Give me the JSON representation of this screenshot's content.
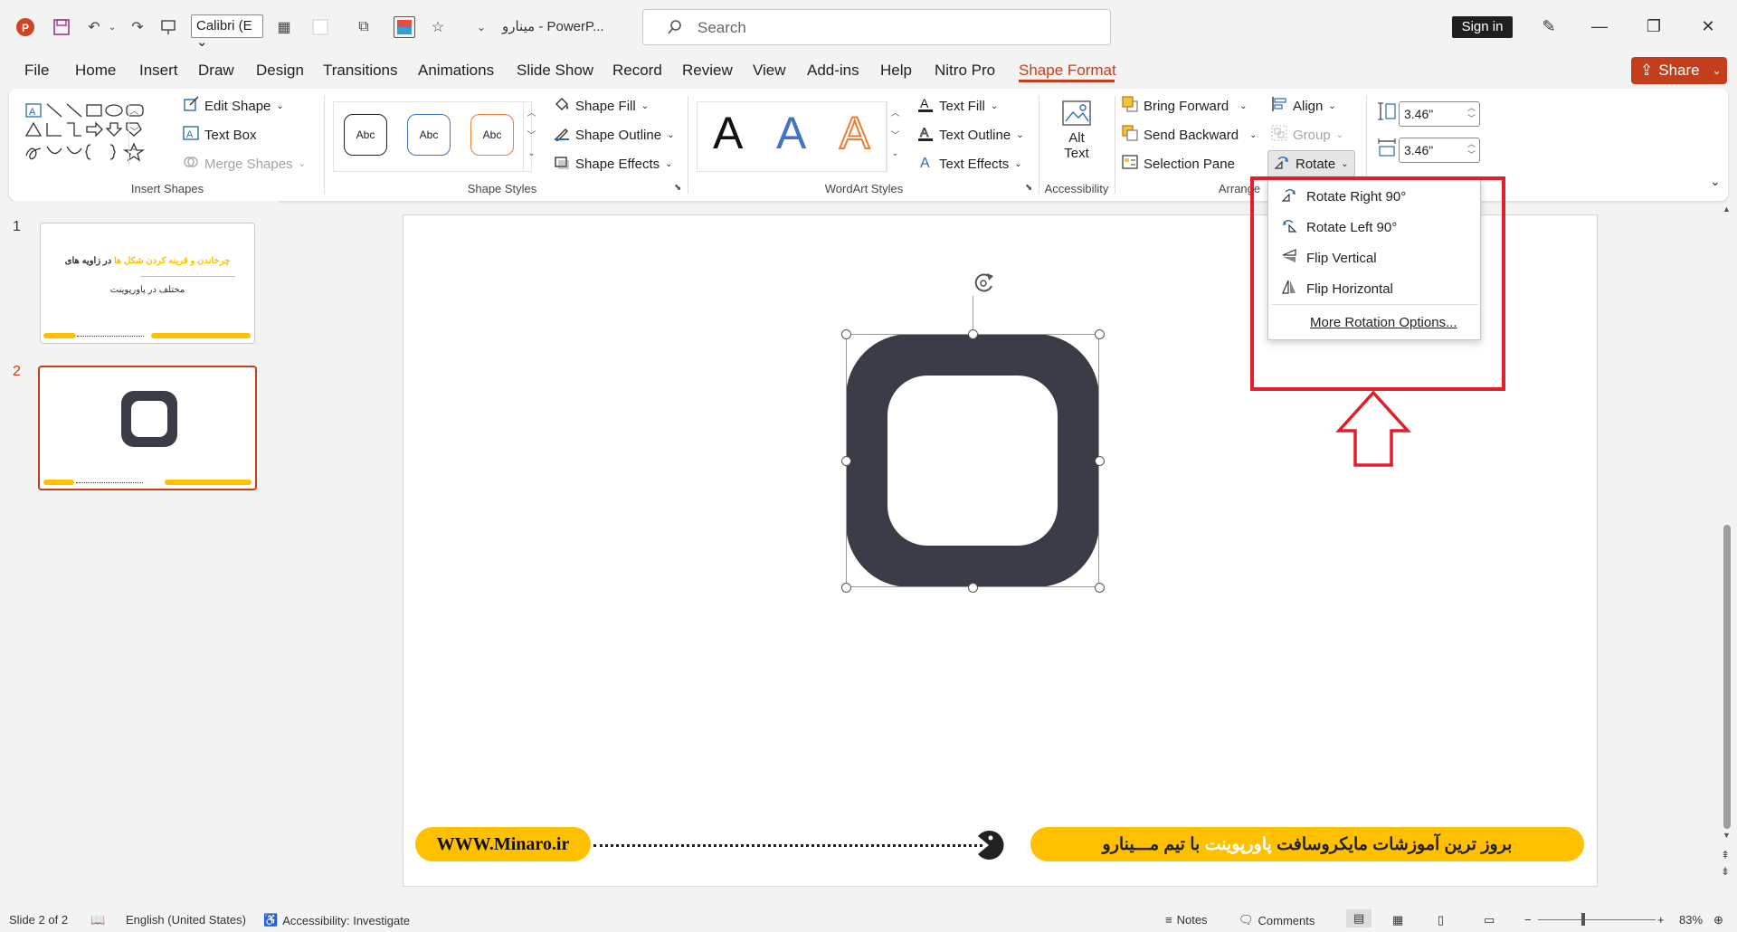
{
  "app": {
    "doc_title": "مینارو  -  PowerP...",
    "font_name": "Calibri (E",
    "search_placeholder": "Search",
    "sign_in": "Sign in"
  },
  "tabs": [
    "File",
    "Home",
    "Insert",
    "Draw",
    "Design",
    "Transitions",
    "Animations",
    "Slide Show",
    "Record",
    "Review",
    "View",
    "Add-ins",
    "Help",
    "Nitro Pro",
    "Shape Format"
  ],
  "active_tab": "Shape Format",
  "share_label": "Share",
  "ribbon": {
    "insert_shapes": {
      "label": "Insert Shapes",
      "edit_shape": "Edit Shape",
      "text_box": "Text Box",
      "merge_shapes": "Merge Shapes"
    },
    "shape_styles": {
      "label": "Shape Styles",
      "preset_text": [
        "Abc",
        "Abc",
        "Abc"
      ],
      "preset_colors": [
        "#222222",
        "#4472c4",
        "#ed7d31"
      ],
      "shape_fill": "Shape Fill",
      "shape_outline": "Shape Outline",
      "shape_effects": "Shape Effects"
    },
    "wordart_styles": {
      "label": "WordArt Styles",
      "letters": [
        "A",
        "A",
        "A"
      ],
      "text_fill": "Text Fill",
      "text_outline": "Text Outline",
      "text_effects": "Text Effects"
    },
    "accessibility": {
      "label": "Accessibility",
      "alt_text_1": "Alt",
      "alt_text_2": "Text"
    },
    "arrange": {
      "label": "Arrange",
      "bring_forward": "Bring Forward",
      "send_backward": "Send Backward",
      "selection_pane": "Selection Pane",
      "align": "Align",
      "group": "Group",
      "rotate": "Rotate"
    },
    "size": {
      "height": "3.46\"",
      "width": "3.46\""
    }
  },
  "rotate_menu": {
    "items": [
      "Rotate Right 90°",
      "Rotate Left 90°",
      "Flip Vertical",
      "Flip Horizontal"
    ],
    "more": "More Rotation Options..."
  },
  "thumbnails": {
    "numbers": [
      "1",
      "2"
    ],
    "slide1_line1_dark": "در زاویه های",
    "slide1_line1_accent": "چرخاندن و قرینه کردن شکل ها",
    "slide1_line2": "مختلف در پاورپوینت"
  },
  "slide": {
    "url": "WWW.Minaro.ir",
    "banner_part1": "بروز ترین آموزشات مایکروسافت",
    "banner_accent": "پاورپوینت",
    "banner_part2": "با تیم مـــینارو",
    "shape_color": "#3a3d47",
    "accent_color": "#ffc000"
  },
  "status": {
    "slide_pos": "Slide 2 of 2",
    "language": "English (United States)",
    "accessibility": "Accessibility: Investigate",
    "notes": "Notes",
    "comments": "Comments",
    "zoom": "83%"
  }
}
